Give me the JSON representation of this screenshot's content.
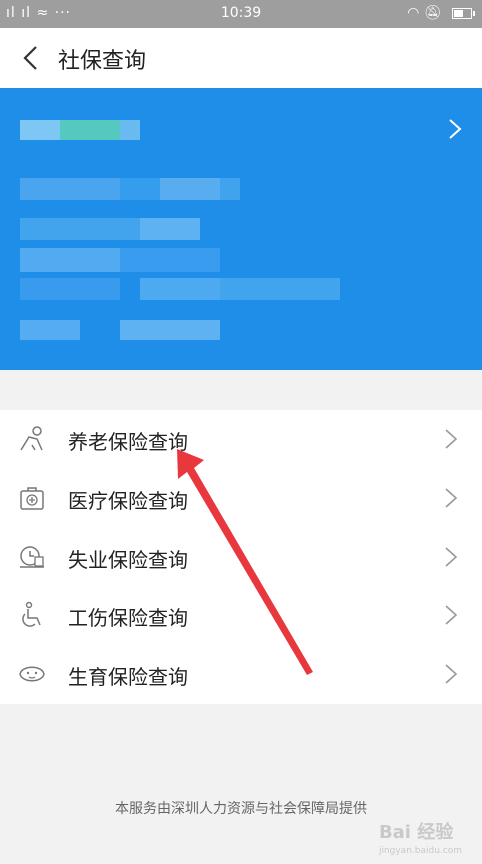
{
  "status_bar": {
    "time": "10:39",
    "signal_text": "ıl ıl ≈ ···"
  },
  "header": {
    "title": "社保查询"
  },
  "menu": {
    "items": [
      {
        "label": "养老保险查询",
        "icon": "elderly-person-icon"
      },
      {
        "label": "医疗保险查询",
        "icon": "medical-kit-icon"
      },
      {
        "label": "失业保险查询",
        "icon": "clock-laptop-icon"
      },
      {
        "label": "工伤保险查询",
        "icon": "wheelchair-icon"
      },
      {
        "label": "生育保险查询",
        "icon": "baby-icon"
      }
    ]
  },
  "footer": {
    "text": "本服务由深圳人力资源与社会保障局提供"
  },
  "watermark": {
    "brand": "Bai 经验",
    "url": "jingyan.baidu.com"
  },
  "colors": {
    "banner": "#1e8ee8",
    "annotation_arrow": "#e8383d"
  }
}
